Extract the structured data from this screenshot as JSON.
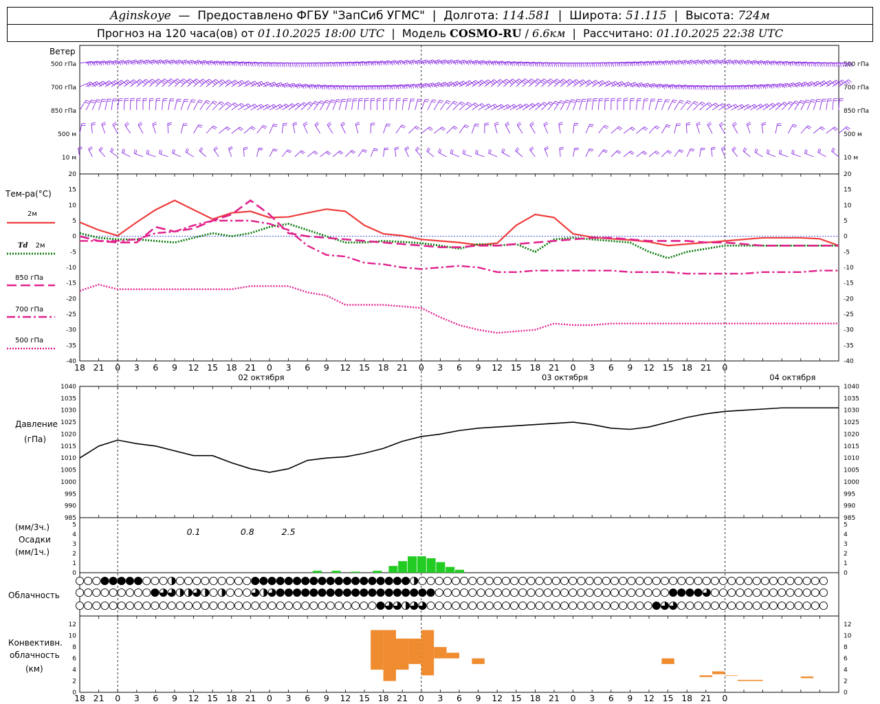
{
  "header": {
    "station": "Aginskoye",
    "provider": "Предоставлено ФГБУ \"ЗапСиб УГМС\"",
    "lon_label": "Долгота:",
    "lon": "114.581",
    "lat_label": "Широта:",
    "lat": "51.115",
    "alt_label": "Высота:",
    "alt": "724м",
    "forecast_label": "Прогноз на 120 часа(ов) от",
    "init_time": "01.10.2025 18:00 UTC",
    "model_label": "Модель",
    "model": "COSMO-RU",
    "resolution": "6.6км",
    "calc_label": "Рассчитано:",
    "calc_time": "01.10.2025 22:38 UTC"
  },
  "labels": {
    "wind": "Ветер",
    "levels": [
      "500 гПа",
      "700 гПа",
      "850 гПа",
      "500 м",
      "10  м"
    ],
    "temp": "Тем-ра(°C)",
    "t2m": "2м",
    "td": "Td",
    "td_sub": "2м",
    "t850": "850 гПа",
    "t700": "700 гПа",
    "t500": "500 гПа",
    "pressure": "Давление",
    "pressure_unit": "(гПа)",
    "precip_unit1": "(мм/3ч.)",
    "precip": "Осадки",
    "precip_unit2": "(мм/1ч.)",
    "cloud": "Облачность",
    "conv1": "Конвективн.",
    "conv2": "облачность",
    "conv3": "(км)"
  },
  "colors": {
    "wind": "#8a2be2",
    "t2m": "#ee3b3b",
    "td": "#0a7a0a",
    "upper": "#e0208c",
    "zero_line": "#2030d0",
    "precip": "#22cc22",
    "conv": "#f08c30",
    "pressure": "#000000"
  },
  "chart_data": [
    {
      "type": "line",
      "name": "temperature",
      "x_hours": [
        0,
        3,
        6,
        9,
        12,
        15,
        18,
        21,
        24,
        27,
        30,
        33,
        36,
        39,
        42,
        45,
        48,
        51,
        54,
        57,
        60,
        63,
        66,
        69,
        72,
        75,
        78,
        81,
        84,
        87,
        90,
        93,
        96,
        99,
        102,
        105,
        108,
        111,
        114,
        117,
        120
      ],
      "hour_ticks": [
        "18",
        "21",
        "0",
        "3",
        "6",
        "9",
        "12",
        "15",
        "18",
        "21",
        "0",
        "3",
        "6",
        "9",
        "12",
        "15",
        "18",
        "21",
        "0",
        "3",
        "6",
        "9",
        "12",
        "15",
        "18",
        "21",
        "0",
        "3",
        "6",
        "9",
        "12",
        "15",
        "18",
        "21",
        "0"
      ],
      "day_labels": [
        "02 октября",
        "03 октября",
        "04 октября"
      ],
      "ylim": [
        -40,
        20
      ],
      "yticks": [
        20,
        15,
        10,
        5,
        0,
        -5,
        -10,
        -15,
        -20,
        -25,
        -30,
        -35,
        -40
      ],
      "series": [
        {
          "name": "2м",
          "style": "solid",
          "values": [
            4.5,
            2,
            0.2,
            4.5,
            8.5,
            11.5,
            8.5,
            5.5,
            7.5,
            8,
            6,
            6.2,
            7.5,
            8.7,
            8,
            3.5,
            0.8,
            0.2,
            -1,
            -1.5,
            -2,
            -2.8,
            -2.2,
            3.5,
            7,
            6,
            0.8,
            -0.3,
            -0.8,
            -1.2,
            -1.8,
            -3,
            -2.5,
            -2,
            -1.5,
            -1,
            -0.5,
            -0.5,
            -0.5,
            -0.8,
            -3
          ]
        },
        {
          "name": "Td 2м",
          "style": "dotted",
          "values": [
            1,
            -0.5,
            -1,
            -1,
            -1.5,
            -2,
            -0.5,
            1,
            0,
            1,
            3,
            4,
            2,
            0,
            -2,
            -2,
            -1.5,
            -1.8,
            -2.2,
            -3,
            -4,
            -2.5,
            -3,
            -2.5,
            -5,
            -1,
            -0.5,
            -1,
            -1.5,
            -2,
            -5,
            -7,
            -5,
            -4,
            -3,
            -3,
            -3,
            -3,
            -3,
            -3,
            -3
          ]
        },
        {
          "name": "850 гПа",
          "style": "dashed",
          "values": [
            0,
            -1.5,
            -2,
            -2,
            3,
            1.5,
            2.5,
            5,
            7,
            11.5,
            7,
            1,
            0,
            -0.5,
            -1,
            -1.5,
            -2,
            -2.5,
            -3,
            -3.5,
            -3.5,
            -3,
            -3,
            -2.5,
            -2,
            -1.5,
            -1,
            -0.5,
            -0.5,
            -1,
            -1.5,
            -1.5,
            -1.5,
            -2,
            -2,
            -2.5,
            -3,
            -3,
            -3,
            -3,
            -3
          ]
        },
        {
          "name": "700 гПа",
          "style": "dashdot",
          "values": [
            -1.5,
            -1.5,
            -1.5,
            -1,
            1,
            1.5,
            3.5,
            5,
            5,
            5,
            4,
            2,
            -3,
            -6,
            -6.5,
            -8.5,
            -9,
            -10,
            -10.5,
            -10,
            -9.5,
            -10,
            -11.5,
            -11.5,
            -11,
            -11,
            -11,
            -11,
            -11,
            -11.5,
            -11.5,
            -11.5,
            -12,
            -12,
            -12,
            -12,
            -11.5,
            -11.5,
            -11.5,
            -11,
            -11
          ]
        },
        {
          "name": "500 гПа",
          "style": "dotted",
          "values": [
            -17.5,
            -15.5,
            -17,
            -17,
            -17,
            -17,
            -17,
            -17,
            -17,
            -16,
            -16,
            -16,
            -18,
            -19,
            -22,
            -22,
            -22,
            -22.5,
            -23,
            -26,
            -28.5,
            -30,
            -31,
            -30.5,
            -30,
            -28,
            -28.5,
            -28.5,
            -28,
            -28,
            -28,
            -28,
            -28,
            -28,
            -28,
            -28,
            -28,
            -28,
            -28,
            -28,
            -28
          ]
        }
      ]
    },
    {
      "type": "line",
      "name": "pressure",
      "x_hours": [
        0,
        3,
        6,
        9,
        12,
        15,
        18,
        21,
        24,
        27,
        30,
        33,
        36,
        39,
        42,
        45,
        48,
        51,
        54,
        57,
        60,
        63,
        66,
        69,
        72,
        75,
        78,
        81,
        84,
        87,
        90,
        93,
        96,
        99,
        102,
        105,
        108,
        111,
        114,
        117,
        120
      ],
      "ylim": [
        985,
        1040
      ],
      "yticks": [
        1040,
        1035,
        1030,
        1025,
        1020,
        1015,
        1010,
        1005,
        1000,
        995,
        990,
        985
      ],
      "values": [
        1010,
        1015,
        1017.5,
        1016,
        1015,
        1013,
        1011,
        1011,
        1008,
        1005.5,
        1004,
        1005.5,
        1009,
        1010,
        1010.5,
        1012,
        1014,
        1017,
        1019,
        1020,
        1021.5,
        1022.5,
        1023,
        1023.5,
        1024,
        1024.5,
        1025,
        1024,
        1022.5,
        1022,
        1023,
        1025,
        1027,
        1028.5,
        1029.5,
        1030,
        1030.5,
        1031,
        1031,
        1031,
        1031
      ]
    },
    {
      "type": "bar",
      "name": "precipitation",
      "values_3h_printed": [
        "0.1",
        "0.8",
        "2.5"
      ],
      "values_3h_hours": [
        18,
        26.5,
        33
      ],
      "bars_1h": [
        [
          37.5,
          0.2
        ],
        [
          40.5,
          0.2
        ],
        [
          43.5,
          0.1
        ],
        [
          47,
          0.2
        ],
        [
          49.5,
          0.7
        ],
        [
          51,
          1.2
        ],
        [
          52.5,
          1.7
        ],
        [
          54,
          1.7
        ],
        [
          55.5,
          1.5
        ],
        [
          57,
          1.1
        ],
        [
          58.5,
          0.6
        ],
        [
          60,
          0.3
        ]
      ],
      "ylim": [
        0,
        5
      ],
      "yticks": [
        5,
        4,
        3,
        2,
        1,
        0
      ]
    },
    {
      "type": "table",
      "name": "cloudiness",
      "rows": [
        "cccfffffccchcccccccccfffffffffffffffffffhcccccccccccccccccccccccccccccccccccccccccccccccccc",
        "cccccccccfqqhhqhchcccqhqfffffffffffffffffffccccccccccccccccccccccccccccffffqcccccccccccccccccc",
        "ccccccccccccccccccccccccccccccccccccfqqhqqcccccccccccccccccccccccccccfqqccccccccccccccccccccc"
      ]
    },
    {
      "type": "bar",
      "name": "convective_cloud",
      "ylim": [
        0,
        13
      ],
      "yticks": [
        12,
        10,
        8,
        6,
        4,
        2,
        0
      ],
      "bars": [
        [
          34,
          36,
          6,
          5
        ],
        [
          44,
          46,
          7,
          5
        ],
        [
          45,
          47,
          6,
          5
        ],
        [
          46,
          48,
          4,
          11
        ],
        [
          48,
          50,
          2,
          11
        ],
        [
          50,
          52,
          4,
          9.5
        ],
        [
          52,
          54,
          5,
          9.5
        ],
        [
          54,
          56,
          3,
          11
        ],
        [
          56,
          58,
          6,
          8
        ],
        [
          58,
          60,
          6,
          7
        ],
        [
          61,
          63,
          2,
          1.5
        ],
        [
          62,
          64,
          5,
          6
        ],
        [
          65,
          67,
          1.5,
          1.3
        ],
        [
          92,
          94,
          5,
          6
        ],
        [
          98,
          100,
          2.7,
          3
        ],
        [
          100,
          102,
          3.2,
          3.7
        ],
        [
          102,
          104,
          2.9,
          3
        ],
        [
          104,
          106,
          2,
          2.2
        ],
        [
          106,
          108,
          2,
          2.2
        ],
        [
          114,
          116,
          2.5,
          2.8
        ]
      ]
    }
  ]
}
